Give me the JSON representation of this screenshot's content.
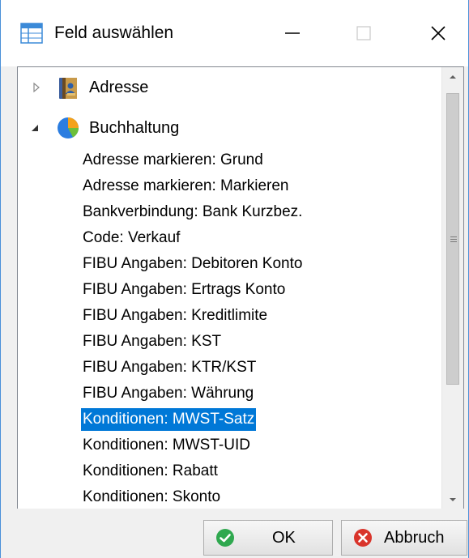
{
  "window": {
    "title": "Feld auswählen",
    "buttons": [
      "minimize",
      "maximize",
      "close"
    ]
  },
  "tree": {
    "nodes": [
      {
        "label": "Adresse",
        "expanded": false,
        "icon": "address-book-icon"
      },
      {
        "label": "Buchhaltung",
        "expanded": true,
        "icon": "pie-chart-icon"
      }
    ],
    "children": [
      "Adresse markieren: Grund",
      "Adresse markieren: Markieren",
      "Bankverbindung: Bank Kurzbez.",
      "Code: Verkauf",
      "FIBU Angaben: Debitoren Konto",
      "FIBU Angaben: Ertrags Konto",
      "FIBU Angaben: Kreditlimite",
      "FIBU Angaben: KST",
      "FIBU Angaben: KTR/KST",
      "FIBU Angaben: Währung",
      "Konditionen: MWST-Satz",
      "Konditionen: MWST-UID",
      "Konditionen: Rabatt",
      "Konditionen: Skonto"
    ],
    "selected": "Konditionen: MWST-Satz"
  },
  "footer": {
    "ok_label": "OK",
    "cancel_label": "Abbruch"
  },
  "colors": {
    "selection": "#0078d7",
    "ok_icon": "#2fa84f",
    "cancel_icon": "#d9342b",
    "window_border": "#4a90d9"
  }
}
